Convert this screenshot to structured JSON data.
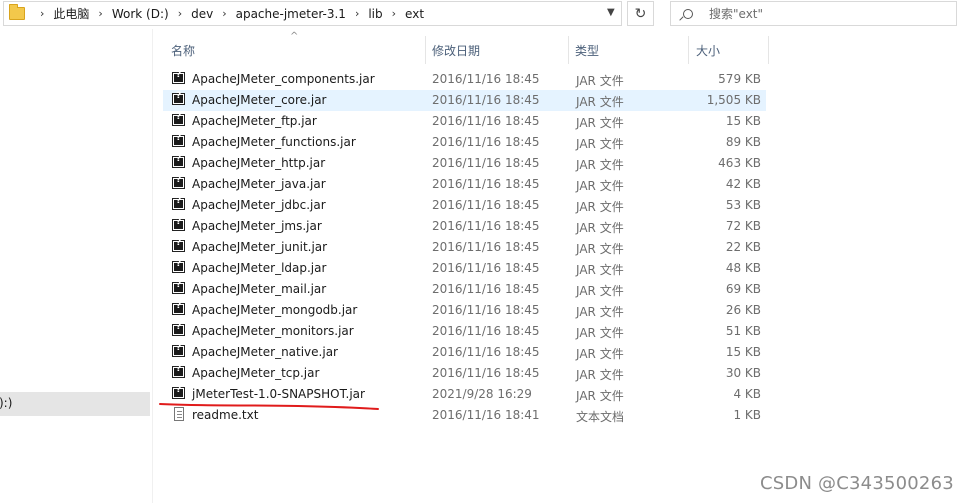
{
  "address": {
    "breadcrumbs": [
      "此电脑",
      "Work (D:)",
      "dev",
      "apache-jmeter-3.1",
      "lib",
      "ext"
    ]
  },
  "search": {
    "placeholder": "搜索\"ext\""
  },
  "nav": {
    "selected_label": "):)"
  },
  "columns": {
    "name": "名称",
    "date": "修改日期",
    "type": "类型",
    "size": "大小"
  },
  "files": [
    {
      "name": "ApacheJMeter_components.jar",
      "date": "2016/11/16 18:45",
      "type": "JAR 文件",
      "size": "579 KB",
      "icon": "jar-file-icon"
    },
    {
      "name": "ApacheJMeter_core.jar",
      "date": "2016/11/16 18:45",
      "type": "JAR 文件",
      "size": "1,505 KB",
      "icon": "jar-file-icon"
    },
    {
      "name": "ApacheJMeter_ftp.jar",
      "date": "2016/11/16 18:45",
      "type": "JAR 文件",
      "size": "15 KB",
      "icon": "jar-file-icon"
    },
    {
      "name": "ApacheJMeter_functions.jar",
      "date": "2016/11/16 18:45",
      "type": "JAR 文件",
      "size": "89 KB",
      "icon": "jar-file-icon"
    },
    {
      "name": "ApacheJMeter_http.jar",
      "date": "2016/11/16 18:45",
      "type": "JAR 文件",
      "size": "463 KB",
      "icon": "jar-file-icon"
    },
    {
      "name": "ApacheJMeter_java.jar",
      "date": "2016/11/16 18:45",
      "type": "JAR 文件",
      "size": "42 KB",
      "icon": "jar-file-icon"
    },
    {
      "name": "ApacheJMeter_jdbc.jar",
      "date": "2016/11/16 18:45",
      "type": "JAR 文件",
      "size": "53 KB",
      "icon": "jar-file-icon"
    },
    {
      "name": "ApacheJMeter_jms.jar",
      "date": "2016/11/16 18:45",
      "type": "JAR 文件",
      "size": "72 KB",
      "icon": "jar-file-icon"
    },
    {
      "name": "ApacheJMeter_junit.jar",
      "date": "2016/11/16 18:45",
      "type": "JAR 文件",
      "size": "22 KB",
      "icon": "jar-file-icon"
    },
    {
      "name": "ApacheJMeter_ldap.jar",
      "date": "2016/11/16 18:45",
      "type": "JAR 文件",
      "size": "48 KB",
      "icon": "jar-file-icon"
    },
    {
      "name": "ApacheJMeter_mail.jar",
      "date": "2016/11/16 18:45",
      "type": "JAR 文件",
      "size": "69 KB",
      "icon": "jar-file-icon"
    },
    {
      "name": "ApacheJMeter_mongodb.jar",
      "date": "2016/11/16 18:45",
      "type": "JAR 文件",
      "size": "26 KB",
      "icon": "jar-file-icon"
    },
    {
      "name": "ApacheJMeter_monitors.jar",
      "date": "2016/11/16 18:45",
      "type": "JAR 文件",
      "size": "51 KB",
      "icon": "jar-file-icon"
    },
    {
      "name": "ApacheJMeter_native.jar",
      "date": "2016/11/16 18:45",
      "type": "JAR 文件",
      "size": "15 KB",
      "icon": "jar-file-icon"
    },
    {
      "name": "ApacheJMeter_tcp.jar",
      "date": "2016/11/16 18:45",
      "type": "JAR 文件",
      "size": "30 KB",
      "icon": "jar-file-icon"
    },
    {
      "name": "jMeterTest-1.0-SNAPSHOT.jar",
      "date": "2021/9/28 16:29",
      "type": "JAR 文件",
      "size": "4 KB",
      "icon": "jar-file-icon"
    },
    {
      "name": "readme.txt",
      "date": "2016/11/16 18:41",
      "type": "文本文档",
      "size": "1 KB",
      "icon": "text-file-icon"
    }
  ],
  "watermark": "CSDN @C343500263",
  "colors": {
    "hover_row": "#e5f3ff",
    "annotation": "#e01b1b",
    "header_text": "#4c607a"
  }
}
